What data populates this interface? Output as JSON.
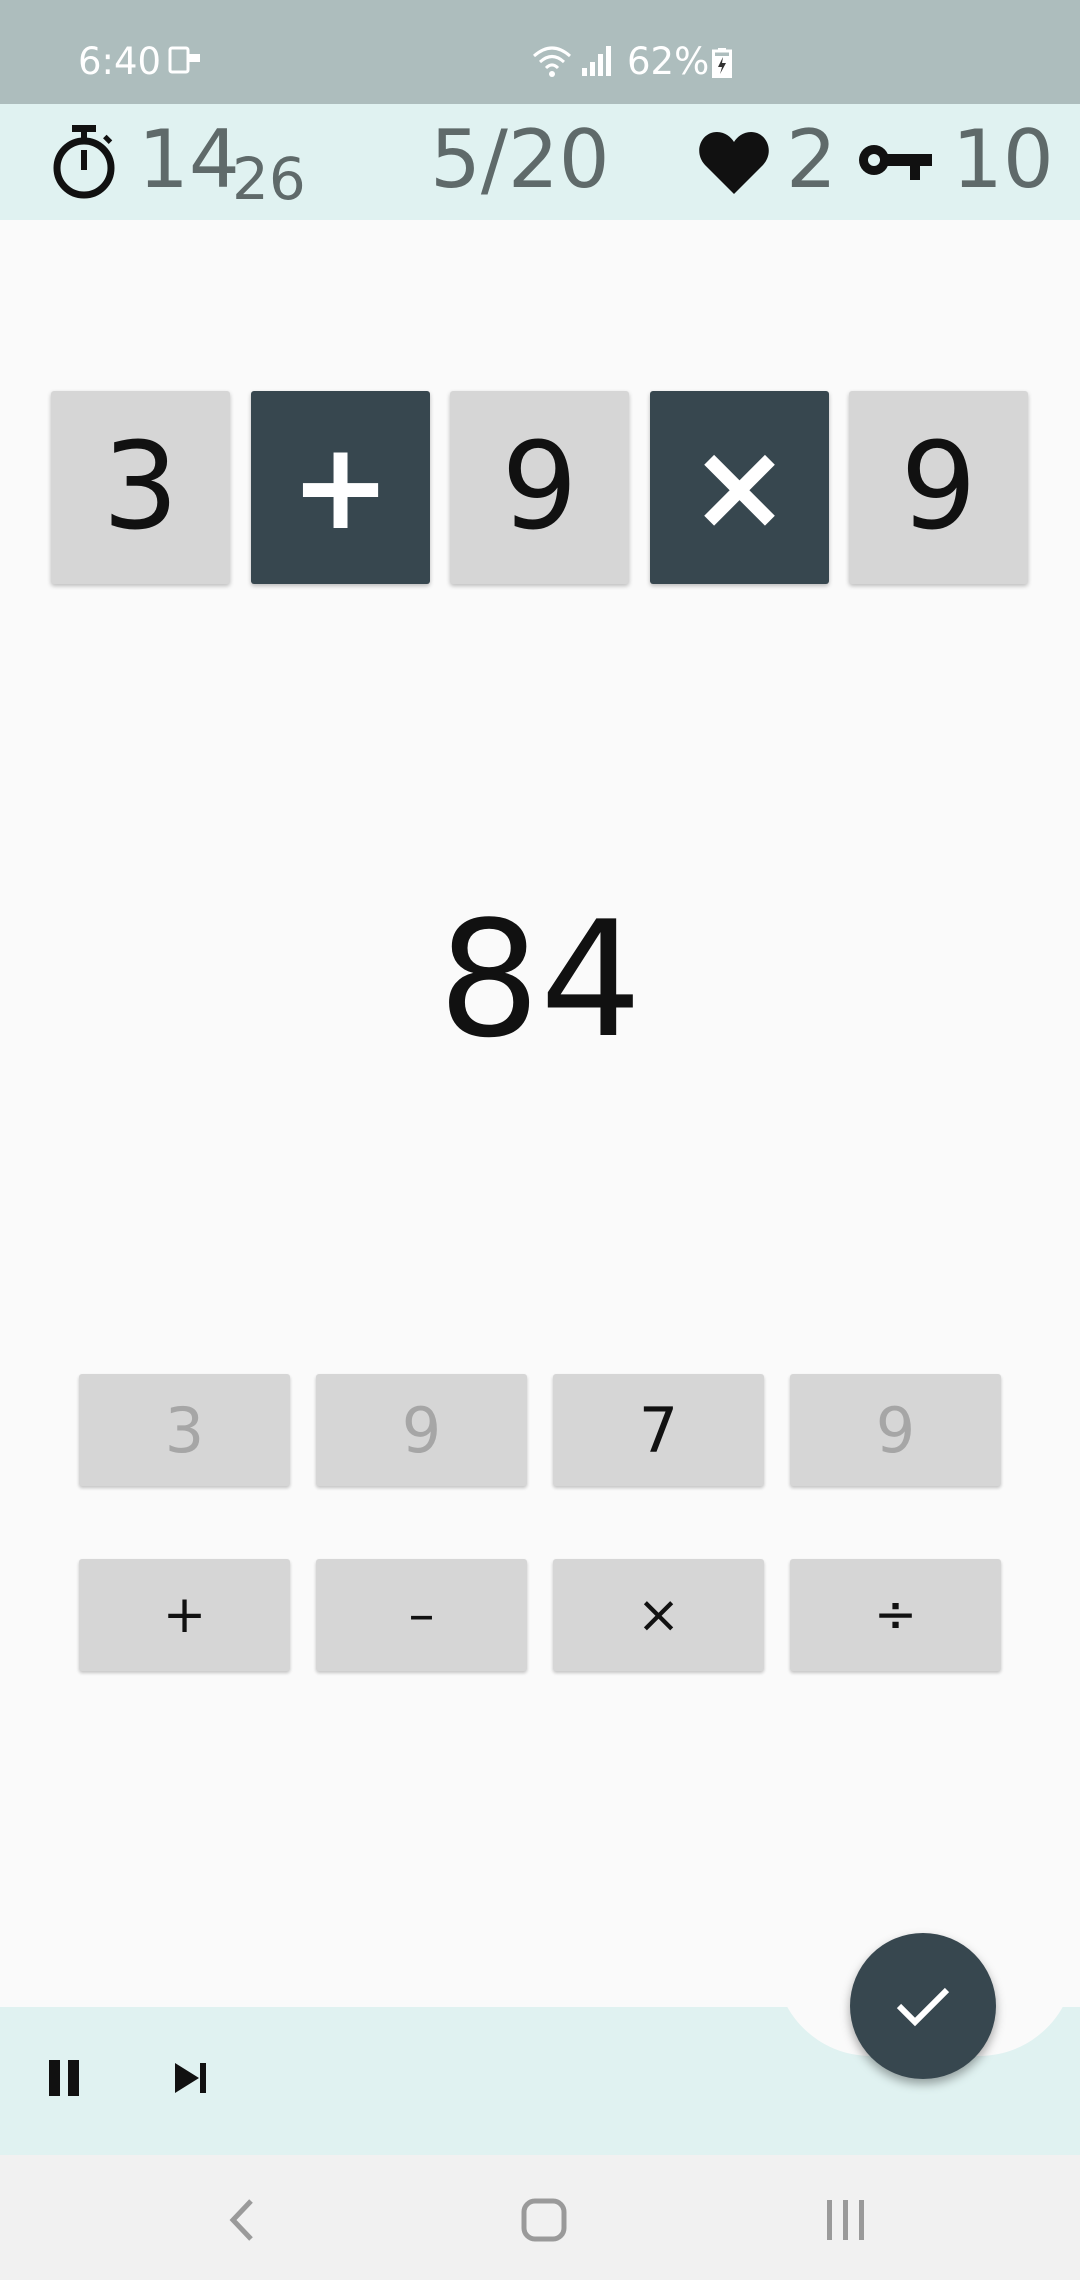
{
  "status_bar": {
    "time": "6:40",
    "battery": "62%"
  },
  "header": {
    "timer_seconds": "14",
    "timer_fraction": "26",
    "level": "5/20",
    "lives": "2",
    "keys": "10"
  },
  "expression": {
    "tiles": [
      {
        "text": "3",
        "kind": "number"
      },
      {
        "text": "+",
        "kind": "operator"
      },
      {
        "text": "9",
        "kind": "number"
      },
      {
        "text": "×",
        "kind": "operator"
      },
      {
        "text": "9",
        "kind": "number"
      }
    ]
  },
  "target": "84",
  "keypad": {
    "digits": [
      {
        "label": "3",
        "used": true
      },
      {
        "label": "9",
        "used": true
      },
      {
        "label": "7",
        "used": false
      },
      {
        "label": "9",
        "used": true
      }
    ],
    "operators": [
      "+",
      "–",
      "×",
      "÷"
    ]
  },
  "icons": {
    "timer": "stopwatch-icon",
    "lives": "heart-icon",
    "keys": "key-icon",
    "pause": "pause-icon",
    "skip": "skip-next-icon",
    "submit": "check-icon"
  },
  "colors": {
    "header_bg": "#e0f2f1",
    "status_bar_bg": "#adbdbd",
    "operator_tile": "#37474f",
    "number_tile": "#d6d6d6",
    "fab": "#37474f"
  }
}
